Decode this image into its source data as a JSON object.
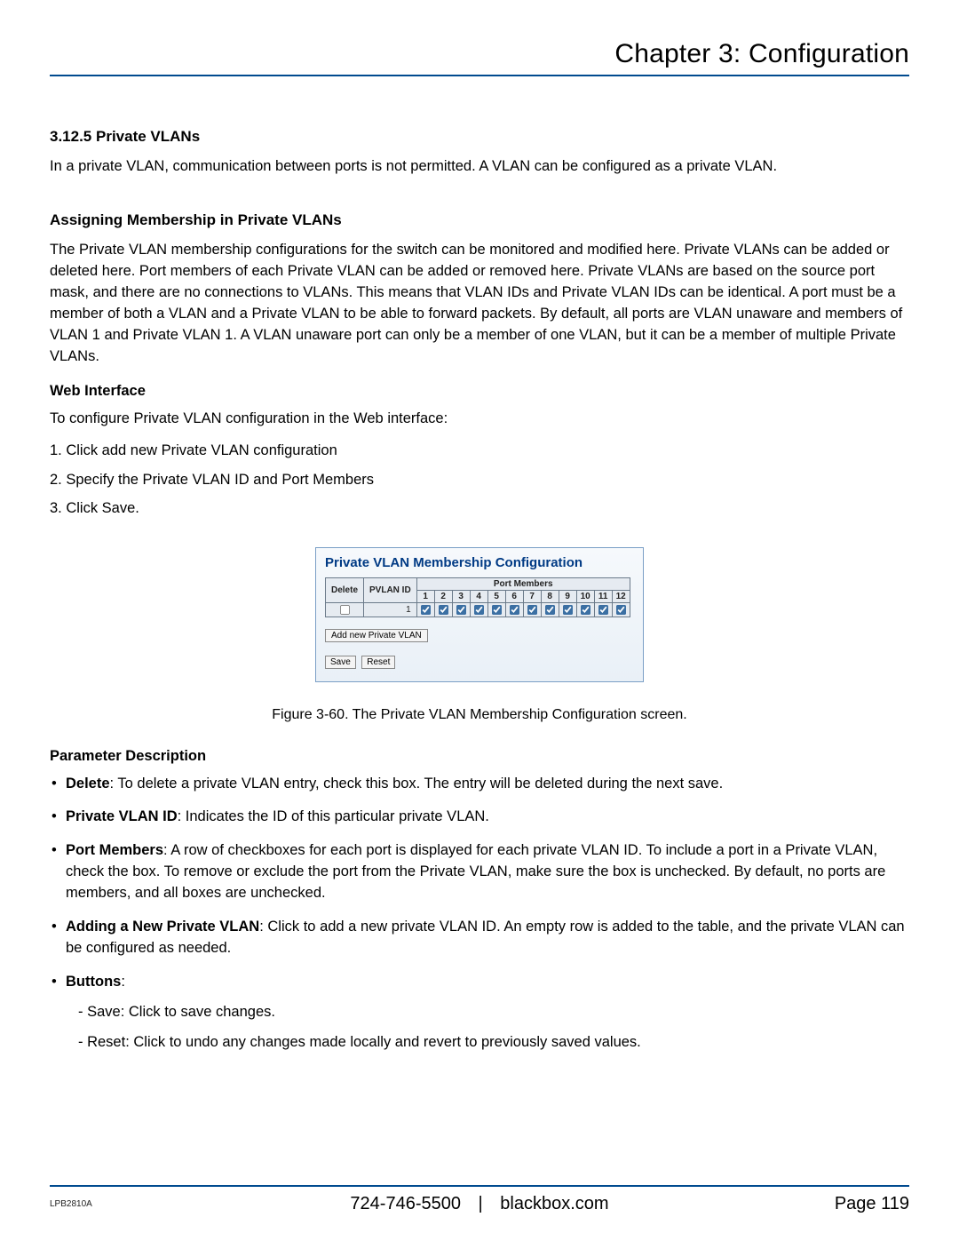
{
  "header": {
    "chapter_title": "Chapter 3: Configuration"
  },
  "section": {
    "number_title": "3.12.5 Private VLANs",
    "intro": "In a private VLAN, communication between ports is not permitted. A VLAN can be configured as a private VLAN."
  },
  "assign": {
    "heading": "Assigning Membership in Private VLANs",
    "body": "The Private VLAN membership configurations for the switch can be monitored and modified here. Private VLANs can be added or deleted here. Port members of each Private VLAN can be added or removed here. Private VLANs are based on the source port mask, and there are no connections to VLANs. This means that VLAN IDs and Private VLAN IDs can be identical. A port must be a member of both a VLAN and a Private VLAN to be able to forward packets. By default, all ports are VLAN unaware and members of VLAN 1 and Private VLAN 1. A VLAN unaware port can only be a member of one VLAN, but it can be a member of multiple Private VLANs."
  },
  "web": {
    "heading": "Web Interface",
    "lead": "To configure Private VLAN configuration in the Web interface:",
    "steps": [
      "1. Click add new Private VLAN configuration",
      "2. Specify the Private VLAN ID and Port Members",
      "3. Click Save."
    ]
  },
  "ui": {
    "title": "Private VLAN Membership Configuration",
    "columns": {
      "delete": "Delete",
      "pvlan_id": "PVLAN ID",
      "port_members": "Port Members"
    },
    "ports": [
      "1",
      "2",
      "3",
      "4",
      "5",
      "6",
      "7",
      "8",
      "9",
      "10",
      "11",
      "12"
    ],
    "rows": [
      {
        "delete_checked": false,
        "pvlan_id": "1",
        "ports_checked": [
          true,
          true,
          true,
          true,
          true,
          true,
          true,
          true,
          true,
          true,
          true,
          true
        ]
      }
    ],
    "add_button": "Add new Private VLAN",
    "save_button": "Save",
    "reset_button": "Reset"
  },
  "figure_caption": "Figure 3-60. The Private VLAN Membership Configuration screen.",
  "params": {
    "heading": "Parameter Description",
    "items": [
      {
        "term": "Delete",
        "desc": ": To delete a private VLAN entry, check this box. The entry will be deleted during the next save."
      },
      {
        "term": "Private VLAN ID",
        "desc": ": Indicates the ID of this particular private VLAN."
      },
      {
        "term": "Port Members",
        "desc": ": A row of checkboxes for each port is displayed for each private VLAN ID. To include a port in a Private VLAN, check the box. To remove or exclude the port from the Private VLAN, make sure the box is unchecked. By default, no ports are members, and all boxes are unchecked."
      },
      {
        "term": "Adding a New Private VLAN",
        "desc": ": Click to add a new private VLAN ID. An empty row is added to the table, and the private VLAN can be configured as needed."
      },
      {
        "term": "Buttons",
        "desc": ":",
        "sub": [
          "Save: Click to save changes.",
          "Reset: Click to undo any changes made locally and revert to previously saved values."
        ]
      }
    ]
  },
  "footer": {
    "model": "LPB2810A",
    "phone": "724-746-5500",
    "site": "blackbox.com",
    "page_label": "Page 119"
  }
}
